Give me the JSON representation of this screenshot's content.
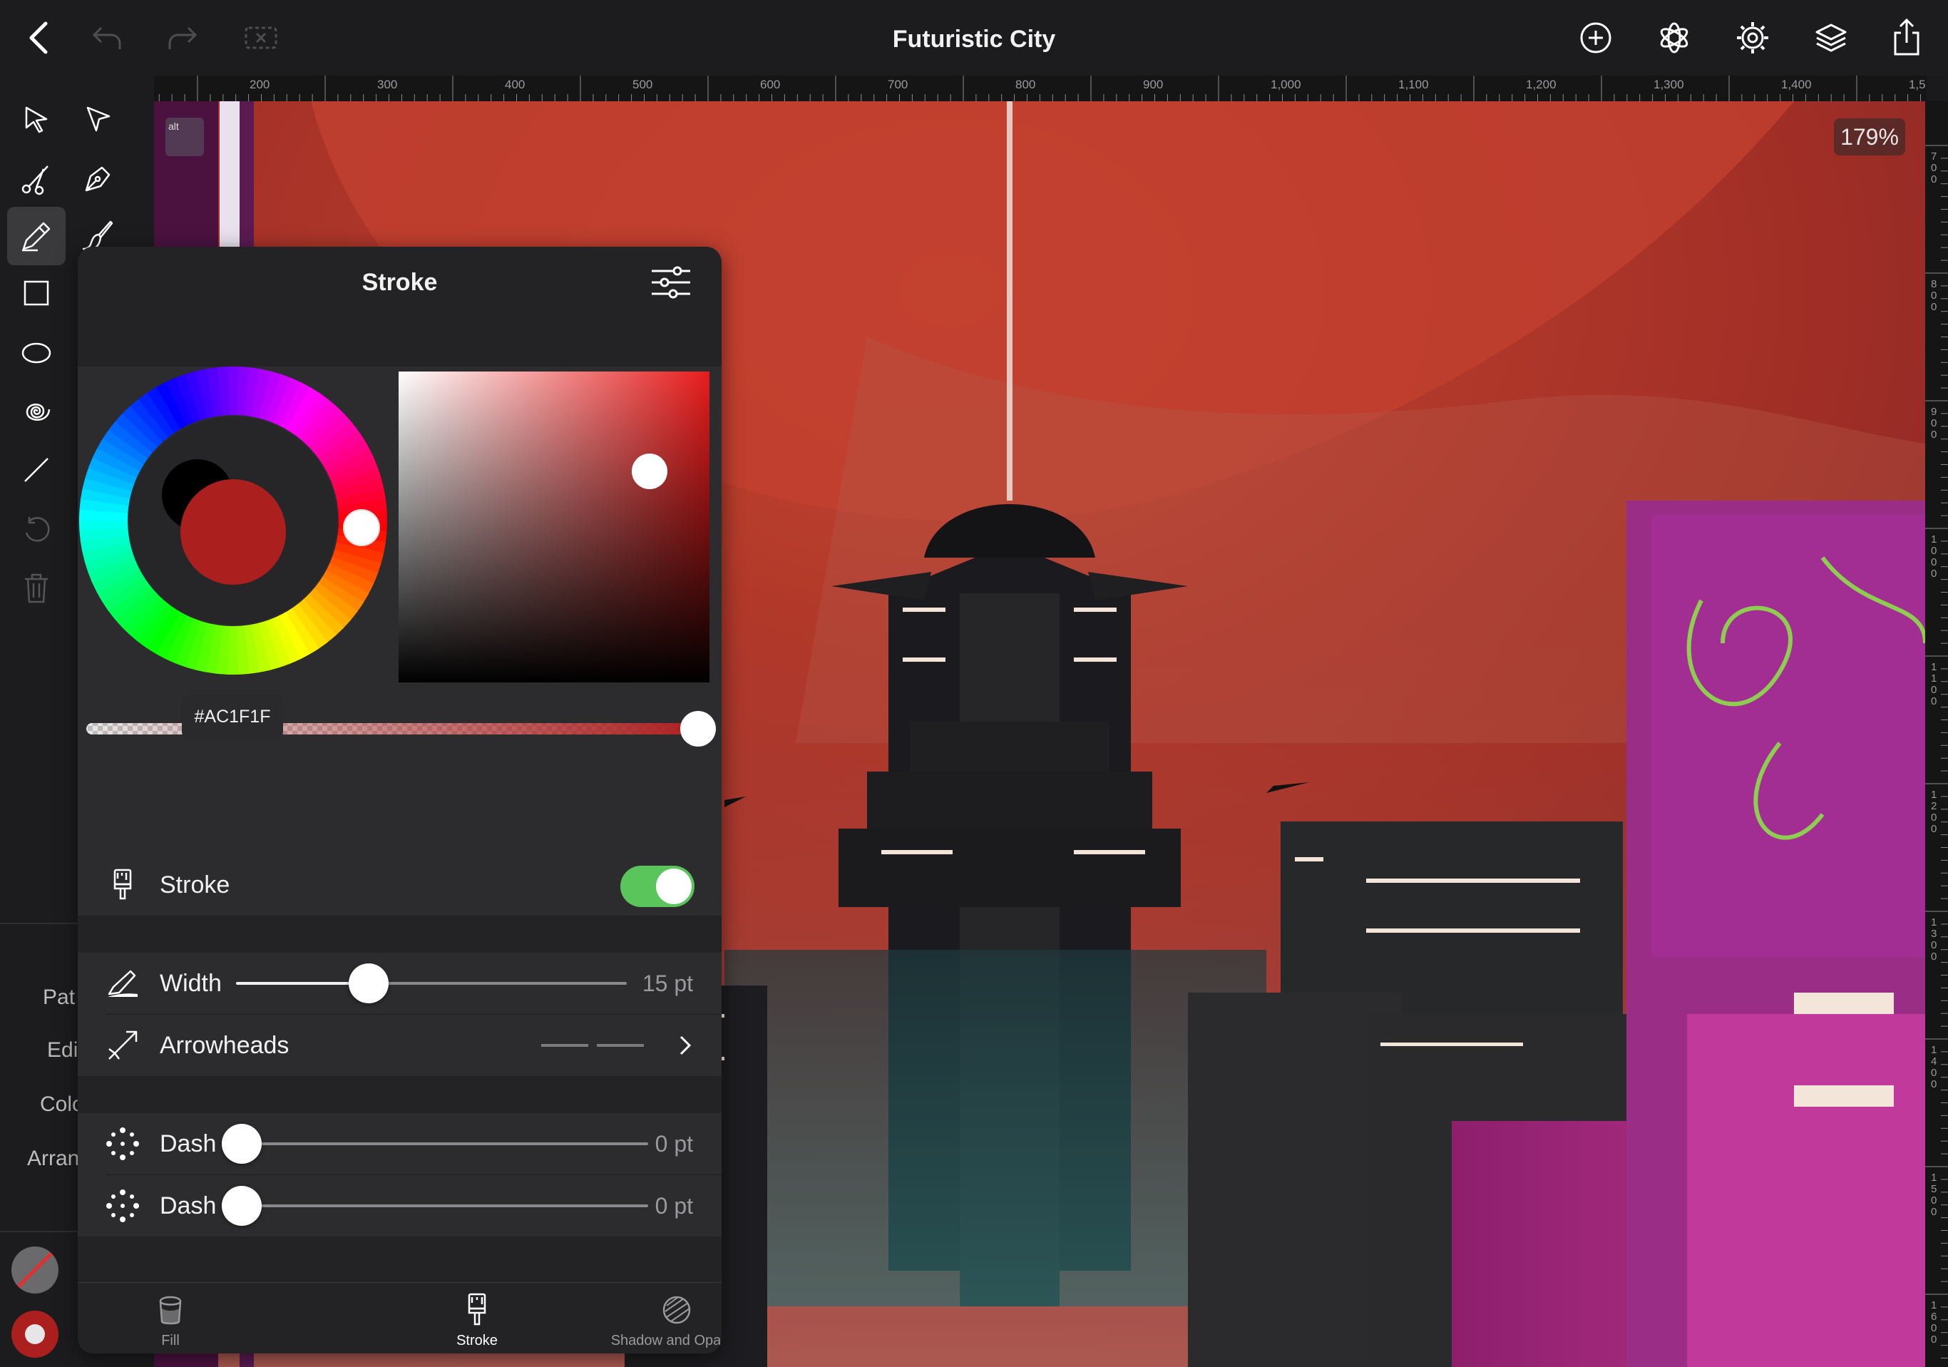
{
  "window": {
    "title": "Futuristic City"
  },
  "topbar": {
    "back_icon": "chevron-left-icon",
    "undo_icon": "undo-icon",
    "redo_icon": "redo-icon",
    "right_icons": [
      "add-circle-icon",
      "symbols-icon",
      "settings-gear-icon",
      "layers-icon",
      "share-icon"
    ]
  },
  "ruler": {
    "top_labels": [
      "200",
      "300",
      "400",
      "500",
      "600",
      "700",
      "800",
      "900",
      "1,000",
      "1,100",
      "1,200",
      "1,300",
      "1,400",
      "1,5"
    ],
    "right_labels": [
      "700",
      "800",
      "900",
      "1,000",
      "1,100",
      "1,200",
      "1,300",
      "1,400",
      "1,500",
      "1,600"
    ]
  },
  "canvas": {
    "zoom": "179%",
    "alt_key": "alt"
  },
  "toolbar": {
    "tools": [
      "selection",
      "direct-selection",
      "scissors",
      "pen",
      "pencil",
      "brush",
      "rectangle",
      "ellipse",
      "spiral",
      "line",
      "rotate",
      "delete"
    ],
    "active_tool": "pencil",
    "labels": [
      "Pat",
      "Edi",
      "Colo",
      "Arran"
    ]
  },
  "stroke_panel": {
    "title": "Stroke",
    "color": {
      "hex": "#AC1F1F",
      "value": "#ac1f1f",
      "previous": "#000000",
      "opacity": 1.0
    },
    "swatches": [
      "#000000",
      "+",
      "+",
      "+",
      "+",
      "+",
      "+",
      "+",
      "+",
      "+"
    ],
    "stroke": {
      "label": "Stroke",
      "enabled": true
    },
    "width": {
      "label": "Width",
      "value": "15 pt",
      "level": 0.34
    },
    "arrowheads": {
      "label": "Arrowheads"
    },
    "dash1": {
      "label": "Dash",
      "value": "0 pt",
      "level": 0
    },
    "dash2": {
      "label": "Dash",
      "value": "0 pt",
      "level": 0
    },
    "tabs": [
      {
        "label": "Fill",
        "icon": "fill-bucket-icon"
      },
      {
        "label": "Stroke",
        "icon": "stroke-brush-icon",
        "active": true
      },
      {
        "label": "Shadow and Opacity",
        "icon": "shadow-opacity-icon"
      }
    ]
  },
  "colors": {
    "accent_green": "#5ac55a",
    "panel_bg": "#2c2c2e",
    "sky_red": "#b8352a"
  }
}
